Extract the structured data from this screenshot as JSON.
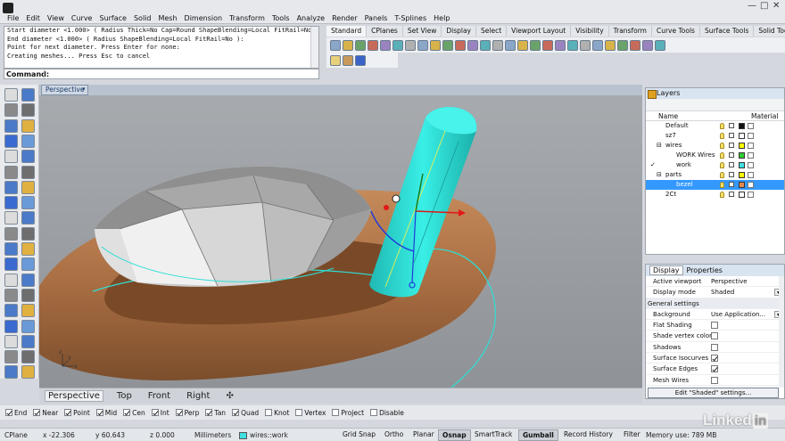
{
  "menu": [
    "File",
    "Edit",
    "View",
    "Curve",
    "Surface",
    "Solid",
    "Mesh",
    "Dimension",
    "Transform",
    "Tools",
    "Analyze",
    "Render",
    "Panels",
    "T-Splines",
    "Help"
  ],
  "window_controls": [
    "—",
    "□",
    "✕"
  ],
  "command_history": [
    "Start diameter <1.000> ( Radius  Thick=No  Cap=Round  ShapeBlending=Local  FitRail=No ):",
    "End diameter <1.000> ( Radius  ShapeBlending=Local  FitRail=No ):",
    "Point for next diameter. Press Enter for none:",
    "Creating meshes... Press Esc to cancel"
  ],
  "command_prompt": {
    "label": "Command:",
    "value": ""
  },
  "toolbar_tabs": [
    "Standard",
    "CPlanes",
    "Set View",
    "Display",
    "Select",
    "Viewport Layout",
    "Visibility",
    "Transform",
    "Curve Tools",
    "Surface Tools",
    "Solid Tools",
    "Mes"
  ],
  "toolbar_tab_active": "Standard",
  "toolbar_icons_row1": [
    "new-icon",
    "open-icon",
    "save-icon",
    "print-icon",
    "import-icon",
    "cut-icon",
    "copy-icon",
    "paste-icon",
    "undo-icon",
    "pan-icon",
    "rotate-view-icon",
    "zoom-icon",
    "zoom-window-icon",
    "zoom-extents-icon",
    "zoom-selected-icon",
    "four-viewports-icon",
    "grid-icon",
    "properties-icon",
    "perspective-icon",
    "shaded-icon",
    "rendered-icon",
    "lightbulb-icon",
    "unlock-icon",
    "layer-icon",
    "render-icon",
    "color-wheel-icon",
    "options-icon"
  ],
  "toolbar_icons_row2": [
    "pin-icon",
    "tools-icon",
    "help-icon"
  ],
  "viewport": {
    "name": "Perspective",
    "dropdown": "▾",
    "axis": {
      "x": "x",
      "y": "y",
      "z": "z"
    },
    "colors": {
      "background": "#9ea2a7",
      "ring": "#b37a4c",
      "gem": "#d0d0d0",
      "prong": "#27d7cf",
      "curve": "#27d7cf"
    }
  },
  "viewport_tabs": [
    "Perspective",
    "Top",
    "Front",
    "Right",
    "✣"
  ],
  "viewport_tab_active": "Perspective",
  "osnaps": [
    {
      "label": "End",
      "on": true
    },
    {
      "label": "Near",
      "on": true
    },
    {
      "label": "Point",
      "on": true
    },
    {
      "label": "Mid",
      "on": true
    },
    {
      "label": "Cen",
      "on": true
    },
    {
      "label": "Int",
      "on": true
    },
    {
      "label": "Perp",
      "on": true
    },
    {
      "label": "Tan",
      "on": true
    },
    {
      "label": "Quad",
      "on": true
    },
    {
      "label": "Knot",
      "on": false
    },
    {
      "label": "Vertex",
      "on": false
    },
    {
      "label": "Project",
      "on": false
    },
    {
      "label": "Disable",
      "on": false
    }
  ],
  "status": {
    "cplane": "CPlane",
    "x": "x -22.306",
    "y": "y 60.643",
    "z": "z 0.000",
    "units": "Millimeters",
    "layer": "wires::work",
    "toggles": [
      {
        "label": "Grid Snap",
        "on": false
      },
      {
        "label": "Ortho",
        "on": false
      },
      {
        "label": "Planar",
        "on": false
      },
      {
        "label": "Osnap",
        "on": true
      },
      {
        "label": "SmartTrack",
        "on": false
      },
      {
        "label": "Gumball",
        "on": true
      },
      {
        "label": "Record History",
        "on": false
      },
      {
        "label": "Filter",
        "on": false
      }
    ],
    "memory": "Memory use: 789 MB"
  },
  "layers_panel": {
    "title": "Layers",
    "col_name": "Name",
    "col_material": "Material",
    "rows": [
      {
        "name": "Default",
        "indent": 0,
        "color": "#111111",
        "selected": false,
        "check": "",
        "twist": ""
      },
      {
        "name": "sz7",
        "indent": 0,
        "color": "#ffffff",
        "selected": false,
        "check": "",
        "twist": ""
      },
      {
        "name": "wires",
        "indent": 0,
        "color": "#ffff00",
        "selected": false,
        "check": "",
        "twist": "⊟"
      },
      {
        "name": "WORK Wires",
        "indent": 1,
        "color": "#33cc33",
        "selected": false,
        "check": "",
        "twist": ""
      },
      {
        "name": "work",
        "indent": 1,
        "color": "#40e0e0",
        "selected": false,
        "check": "✓",
        "twist": ""
      },
      {
        "name": "parts",
        "indent": 0,
        "color": "#ffff00",
        "selected": false,
        "check": "",
        "twist": "⊟"
      },
      {
        "name": "bezel",
        "indent": 1,
        "color": "#e08a50",
        "selected": true,
        "check": "",
        "twist": ""
      },
      {
        "name": "2Ct",
        "indent": 0,
        "color": "#ffffff",
        "selected": false,
        "check": "",
        "twist": ""
      }
    ]
  },
  "props_panel": {
    "tabs": [
      "Display",
      "Properties"
    ],
    "active_tab": "Display",
    "rows": [
      {
        "k": "Active viewport",
        "v": "Perspective",
        "type": "text"
      },
      {
        "k": "Display mode",
        "v": "Shaded",
        "type": "select"
      },
      {
        "k": "General settings",
        "v": "",
        "type": "section"
      },
      {
        "k": "Background",
        "v": "Use Application...",
        "type": "select"
      },
      {
        "k": "Flat Shading",
        "v": "",
        "type": "check",
        "on": false
      },
      {
        "k": "Shade vertex colors",
        "v": "",
        "type": "check",
        "on": false
      },
      {
        "k": "Shadows",
        "v": "",
        "type": "check",
        "on": false
      },
      {
        "k": "Surface Isocurves",
        "v": "",
        "type": "check",
        "on": true
      },
      {
        "k": "Surface Edges",
        "v": "",
        "type": "check",
        "on": true
      },
      {
        "k": "Mesh Wires",
        "v": "",
        "type": "check",
        "on": false
      }
    ],
    "edit_button": "Edit \"Shaded\" settings..."
  },
  "watermark": {
    "text": "Linked",
    "badge": "in"
  }
}
